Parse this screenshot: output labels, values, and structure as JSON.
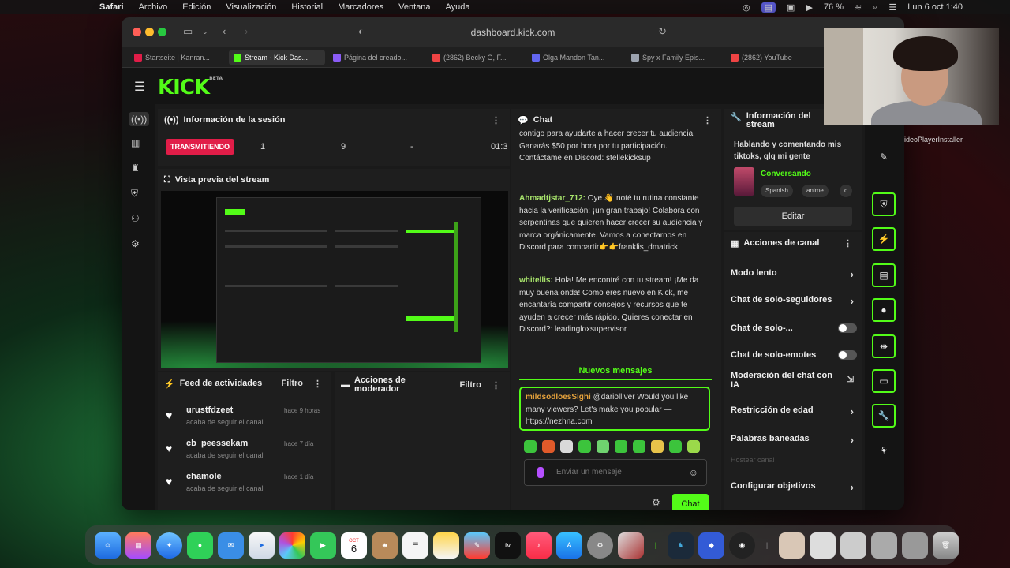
{
  "menubar": {
    "app": "Safari",
    "items": [
      "Archivo",
      "Edición",
      "Visualización",
      "Historial",
      "Marcadores",
      "Ventana",
      "Ayuda"
    ],
    "battery": "76 %",
    "datetime": "Lun 6 oct 1:40"
  },
  "browser": {
    "url": "dashboard.kick.com",
    "tabs": [
      {
        "label": "Startseite | Kanran...",
        "color": "#e11d48"
      },
      {
        "label": "Stream - Kick Das...",
        "color": "#53fc18",
        "active": true
      },
      {
        "label": "Página del creado...",
        "color": "#8b5cf6"
      },
      {
        "label": "(2862) Becky G, F...",
        "color": "#ef4444"
      },
      {
        "label": "Olga Mandon Tan...",
        "color": "#6366f1"
      },
      {
        "label": "Spy x Family Epis...",
        "color": "#9ca3af"
      },
      {
        "label": "(2862) YouTube",
        "color": "#ef4444"
      }
    ]
  },
  "kick": {
    "logo": "KICK",
    "logo_badge": "BETA"
  },
  "session": {
    "title": "Información de la sesión",
    "live_badge": "TRANSMITIENDO",
    "stats": [
      "1",
      "9",
      "-",
      "01:3"
    ]
  },
  "preview": {
    "title": "Vista previa del stream"
  },
  "feed": {
    "title": "Feed de actividades",
    "filter": "Filtro",
    "items": [
      {
        "name": "urustfdzeet",
        "time": "hace 9 horas",
        "desc": "acaba de seguir el canal"
      },
      {
        "name": "cb_peessekam",
        "time": "hace 7 día",
        "desc": "acaba de seguir el canal"
      },
      {
        "name": "chamole",
        "time": "hace 1 día",
        "desc": "acaba de seguir el canal"
      }
    ]
  },
  "modactions": {
    "title": "Acciones de moderador",
    "filter": "Filtro"
  },
  "chat": {
    "title": "Chat",
    "msg0": "contigo para ayudarte a hacer crecer tu audiencia. Ganarás $50 por hora por tu participación. Contáctame en Discord: stellekicksup",
    "msg1_user": "Ahmadtjstar_712:",
    "msg1_text": " Oye 👋 noté tu rutina constante hacia la verificación: ¡un gran trabajo! Colabora con serpentinas que quieren hacer crecer su audiencia y marca orgánicamente. Vamos a conectarnos en Discord para compartir👉👉franklis_dmatrick",
    "msg2_user": "whitellis:",
    "msg2_text": " Hola! Me encontré con tu stream! ¡Me da muy buena onda! Como eres nuevo en Kick, me encantaría compartir consejos y recursos que te ayuden a crecer más rápido. Quieres conectar en Discord?: leadingloxsupervisor",
    "new_messages": "Nuevos mensajes",
    "pinned_user": "mildsodloesSighi",
    "pinned_text": " @dariolliver Would you like many viewers? Let's make you popular — https://nezhna.com",
    "placeholder": "Enviar un mensaje",
    "send": "Chat"
  },
  "streaminfo": {
    "title": "Información del stream",
    "stream_title": "Hablando y comentando mis tiktoks, qlq mi gente",
    "category": "Conversando",
    "tags": [
      "Spanish",
      "anime",
      "c"
    ],
    "edit": "Editar"
  },
  "channel_actions": {
    "title": "Acciones de canal",
    "items": [
      {
        "label": "Modo lento",
        "control": "chevron"
      },
      {
        "label": "Chat de solo-seguidores",
        "control": "chevron"
      },
      {
        "label": "Chat de solo-...",
        "control": "toggle"
      },
      {
        "label": "Chat de solo-emotes",
        "control": "toggle"
      },
      {
        "label": "Moderación del chat con IA",
        "control": "external"
      },
      {
        "label": "Restricción de edad",
        "control": "chevron"
      },
      {
        "label": "Palabras baneadas",
        "control": "chevron"
      },
      {
        "label": "Hostear canal",
        "control": "disabled"
      },
      {
        "label": "Configurar objetivos",
        "control": "chevron"
      }
    ]
  },
  "overlay": {
    "side_label": "ideoPlayerInstaller"
  },
  "dock": {
    "calendar_day": "6",
    "calendar_month": "OCT"
  }
}
